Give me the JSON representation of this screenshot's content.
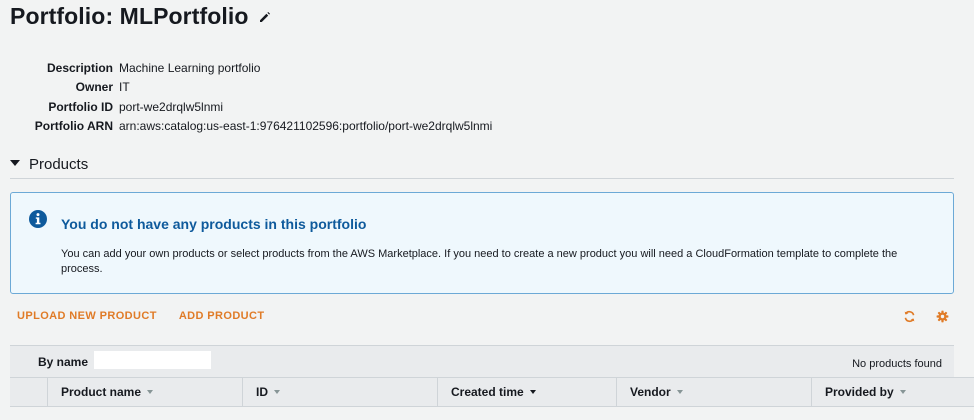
{
  "page": {
    "title": "Portfolio: MLPortfolio"
  },
  "details": [
    {
      "label": "Description",
      "value": "Machine Learning portfolio"
    },
    {
      "label": "Owner",
      "value": "IT"
    },
    {
      "label": "Portfolio ID",
      "value": "port-we2drqlw5lnmi"
    },
    {
      "label": "Portfolio ARN",
      "value": "arn:aws:catalog:us-east-1:976421102596:portfolio/port-we2drqlw5lnmi"
    }
  ],
  "products_section": {
    "heading": "Products",
    "expanded": true
  },
  "info_box": {
    "title": "You do not have any products in this portfolio",
    "message": "You can add your own products or select products from the AWS Marketplace. If you need to create a new product you will need a CloudFormation template to complete the process."
  },
  "actions": {
    "upload": "UPLOAD NEW PRODUCT",
    "add": "ADD PRODUCT"
  },
  "filter": {
    "label": "By name",
    "value": "",
    "status": "No products found"
  },
  "table": {
    "columns": [
      "Product name",
      "ID",
      "Created time",
      "Vendor",
      "Provided by"
    ]
  },
  "colors": {
    "accent_orange": "#e07b27",
    "info_blue": "#0e5a9c",
    "info_bg": "#eff8fd"
  },
  "icons": [
    "pencil-icon",
    "info-icon",
    "refresh-icon",
    "gear-icon",
    "caret-down-icon"
  ]
}
